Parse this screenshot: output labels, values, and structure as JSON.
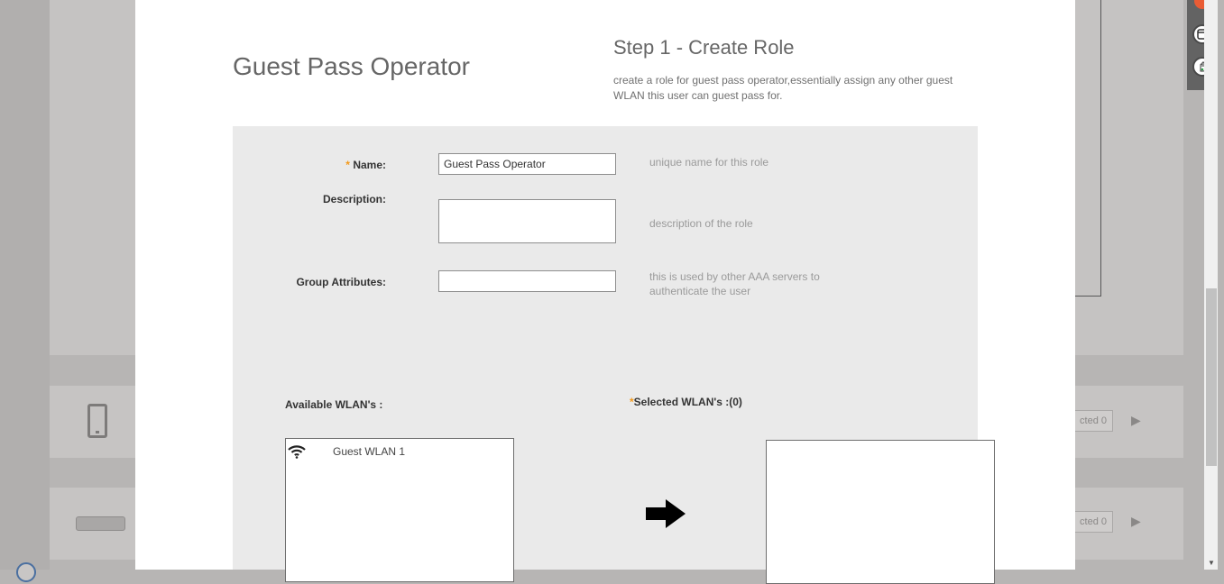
{
  "dialog": {
    "title": "Guest Pass Operator",
    "step_title": "Step 1 - Create Role",
    "step_description": "create a role for guest pass operator,essentially assign any other guest WLAN this user can guest pass for."
  },
  "form": {
    "name": {
      "required_mark": "*",
      "label": "Name:",
      "value": "Guest Pass Operator",
      "hint": "unique name for this role"
    },
    "description": {
      "label": "Description:",
      "value": "",
      "hint": "description of the role"
    },
    "group_attributes": {
      "label": "Group Attributes:",
      "value": "",
      "hint": "this is used by other AAA servers to authenticate the user"
    }
  },
  "wlans": {
    "available_label": "Available WLAN's :",
    "available": [
      {
        "label": "Guest WLAN 1",
        "icon": "wifi-icon"
      }
    ],
    "selected_required_mark": "*",
    "selected_label": "Selected WLAN's :(0)",
    "selected": [],
    "move_icon": "arrow-right-icon"
  },
  "background": {
    "row1_selected_text": "cted 0",
    "row2_selected_text": "cted 0"
  },
  "colors": {
    "required": "#f39a1b",
    "panel": "#eaeaea",
    "overlay": "#b7b5b4"
  }
}
